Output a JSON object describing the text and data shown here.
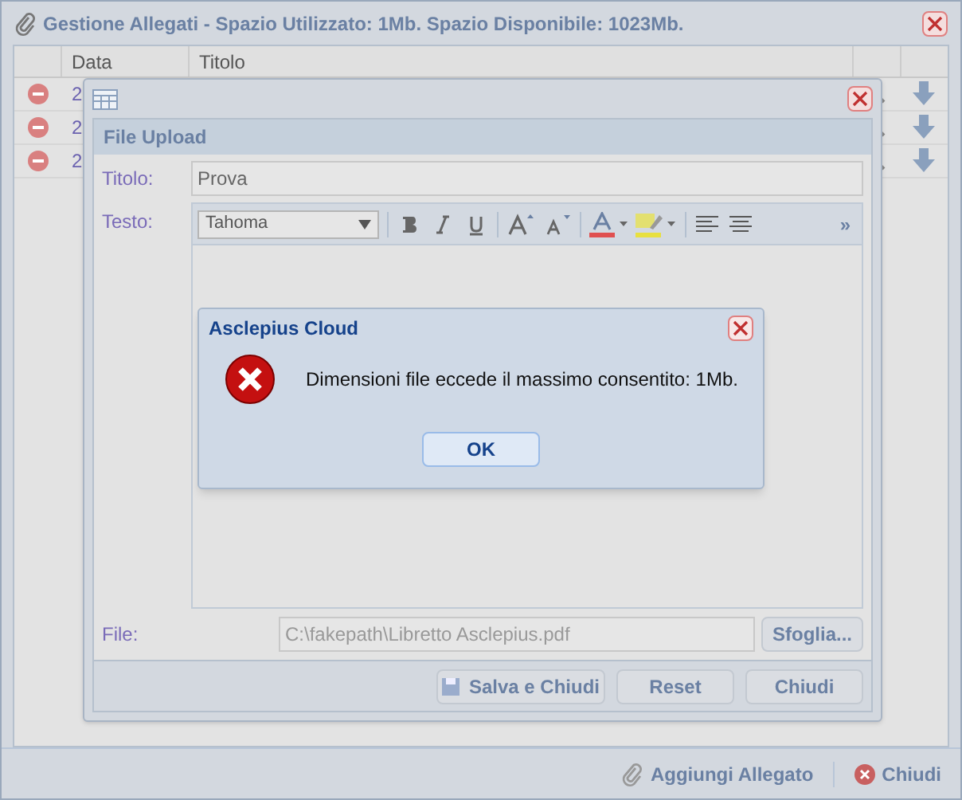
{
  "window": {
    "title": "Gestione Allegati - Spazio Utilizzato: 1Mb. Spazio Disponibile: 1023Mb."
  },
  "table": {
    "columns": [
      "Data",
      "Titolo"
    ],
    "rows": [
      {
        "date": "2"
      },
      {
        "date": "2"
      },
      {
        "date": "2"
      }
    ]
  },
  "toolbar": {
    "buttons": [
      "Aggiungi Allegato",
      "Chiudi"
    ]
  },
  "upload": {
    "title": "File Upload",
    "titolo_label": "Titolo:",
    "titolo_value": "Prova",
    "testo_label": "Testo:",
    "font": "Tahoma",
    "more": "»",
    "file_label": "File:",
    "file_value": "C:\\fakepath\\Libretto Asclepius.pdf",
    "browse": "Sfoglia...",
    "buttons": [
      "Salva e Chiudi",
      "Reset",
      "Chiudi"
    ]
  },
  "alert": {
    "title": "Asclepius Cloud",
    "message": "Dimensioni file eccede il massimo consentito: 1Mb.",
    "button": "OK"
  }
}
